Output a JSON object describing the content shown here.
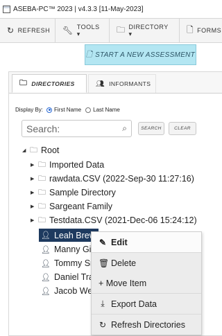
{
  "title_bar": {
    "text": "ASEBA-PC™ 2023 | v4.3.3  [11-May-2023]"
  },
  "toolbar": {
    "buttons": [
      {
        "label": "REFRESH",
        "icon": "refresh-icon"
      },
      {
        "label": "TOOLS ▾",
        "icon": "wrench-icon"
      },
      {
        "label": "DIRECTORY ▾",
        "icon": "folder-icon"
      },
      {
        "label": "FORMS",
        "icon": "document-icon"
      }
    ]
  },
  "start_button": {
    "label": "START A NEW ASSESSMENT",
    "icon": "new-document-icon"
  },
  "tabs": [
    {
      "label": "DIRECTORIES",
      "icon": "folder-icon",
      "active": true
    },
    {
      "label": "INFORMANTS",
      "icon": "people-icon",
      "active": false
    }
  ],
  "display_by": {
    "label": "Display By:",
    "options": [
      {
        "label": "First Name",
        "selected": true
      },
      {
        "label": "Last Name",
        "selected": false
      }
    ]
  },
  "search": {
    "placeholder": "Search:",
    "search_button": "SEARCH",
    "clear_button": "CLEAR"
  },
  "tree": {
    "root": "Root",
    "folders": [
      "Imported Data",
      "rawdata.CSV (2022-Sep-30 11:27:16)",
      "Sample Directory",
      "Sargeant Family",
      "Testdata.CSV (2021-Dec-06 15:24:12)"
    ],
    "people": [
      {
        "name": "Leah Brew",
        "selected": true
      },
      {
        "name": "Manny Gir",
        "selected": false
      },
      {
        "name": "Tommy Sm",
        "selected": false
      },
      {
        "name": "Daniel Tra",
        "selected": false
      },
      {
        "name": "Jacob Wes",
        "selected": false
      }
    ]
  },
  "context_menu": {
    "items": [
      {
        "label": "Edit",
        "icon": "pencil-icon",
        "hover": true
      },
      {
        "label": "Delete",
        "icon": "trash-icon",
        "hover": false
      },
      {
        "label": "+ Move Item",
        "icon": "",
        "hover": false
      },
      {
        "label": "Export Data",
        "icon": "export-icon",
        "hover": false
      },
      {
        "label": "Refresh Directories",
        "icon": "refresh-icon",
        "hover": false
      }
    ]
  },
  "colors": {
    "selected_bg": "#1e3a5f",
    "start_button_bg": "#b3e6f2",
    "toolbar_bg": "#f4f4f4",
    "context_menu_bg": "#ececec"
  }
}
